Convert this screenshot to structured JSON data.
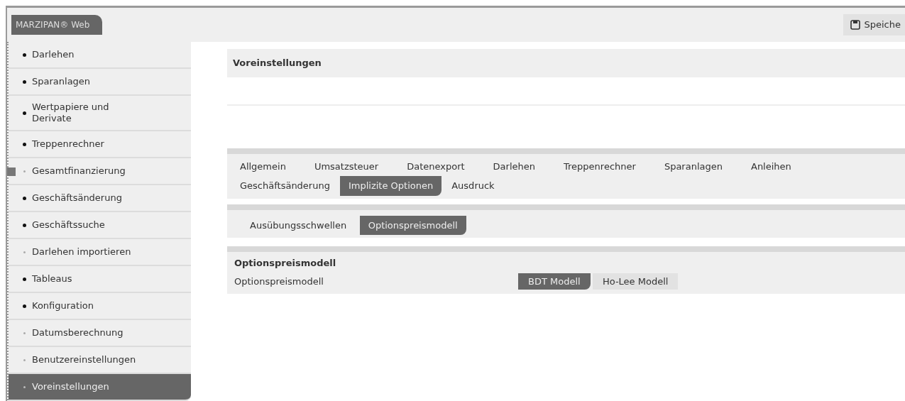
{
  "logo": "MARZIPAN® Web",
  "toolbar": {
    "save_button": "Speiche"
  },
  "sidebar": {
    "items": [
      {
        "label": "Darlehen",
        "kind": "expandable",
        "selected": false,
        "marked": false
      },
      {
        "label": "Sparanlagen",
        "kind": "expandable",
        "selected": false,
        "marked": false
      },
      {
        "label": "Wertpapiere und Derivate",
        "kind": "expandable",
        "selected": false,
        "marked": false
      },
      {
        "label": "Treppenrechner",
        "kind": "expandable",
        "selected": false,
        "marked": false
      },
      {
        "label": "Gesamtfinanzierung",
        "kind": "leaf",
        "selected": false,
        "marked": true
      },
      {
        "label": "Geschäftsänderung",
        "kind": "expandable",
        "selected": false,
        "marked": false
      },
      {
        "label": "Geschäftssuche",
        "kind": "expandable",
        "selected": false,
        "marked": false
      },
      {
        "label": "Darlehen importieren",
        "kind": "leaf",
        "selected": false,
        "marked": false
      },
      {
        "label": "Tableaus",
        "kind": "expandable",
        "selected": false,
        "marked": false
      },
      {
        "label": "Konfiguration",
        "kind": "expandable",
        "selected": false,
        "marked": false
      },
      {
        "label": "Datumsberechnung",
        "kind": "leaf",
        "selected": false,
        "marked": false
      },
      {
        "label": "Benutzereinstellungen",
        "kind": "leaf",
        "selected": false,
        "marked": false
      },
      {
        "label": "Voreinstellungen",
        "kind": "leaf",
        "selected": true,
        "marked": false
      }
    ]
  },
  "page_title": "Voreinstellungen",
  "tabs": [
    [
      {
        "label": "Allgemein",
        "selected": false
      },
      {
        "label": "Umsatzsteuer",
        "selected": false
      },
      {
        "label": "Datenexport",
        "selected": false
      },
      {
        "label": "Darlehen",
        "selected": false
      },
      {
        "label": "Treppenrechner",
        "selected": false
      },
      {
        "label": "Sparanlagen",
        "selected": false
      },
      {
        "label": "Anleihen",
        "selected": false
      }
    ],
    [
      {
        "label": "Geschäftsänderung",
        "selected": false
      },
      {
        "label": "Implizite Optionen",
        "selected": true
      },
      {
        "label": "Ausdruck",
        "selected": false
      }
    ]
  ],
  "subtabs": [
    {
      "label": "Ausübungsschwellen",
      "selected": false
    },
    {
      "label": "Optionspreismodell",
      "selected": true
    }
  ],
  "section": {
    "title": "Optionspreismodell",
    "field_label": "Optionspreismodell",
    "options": [
      {
        "label": "BDT Modell",
        "selected": true
      },
      {
        "label": "Ho-Lee Modell",
        "selected": false
      }
    ]
  }
}
